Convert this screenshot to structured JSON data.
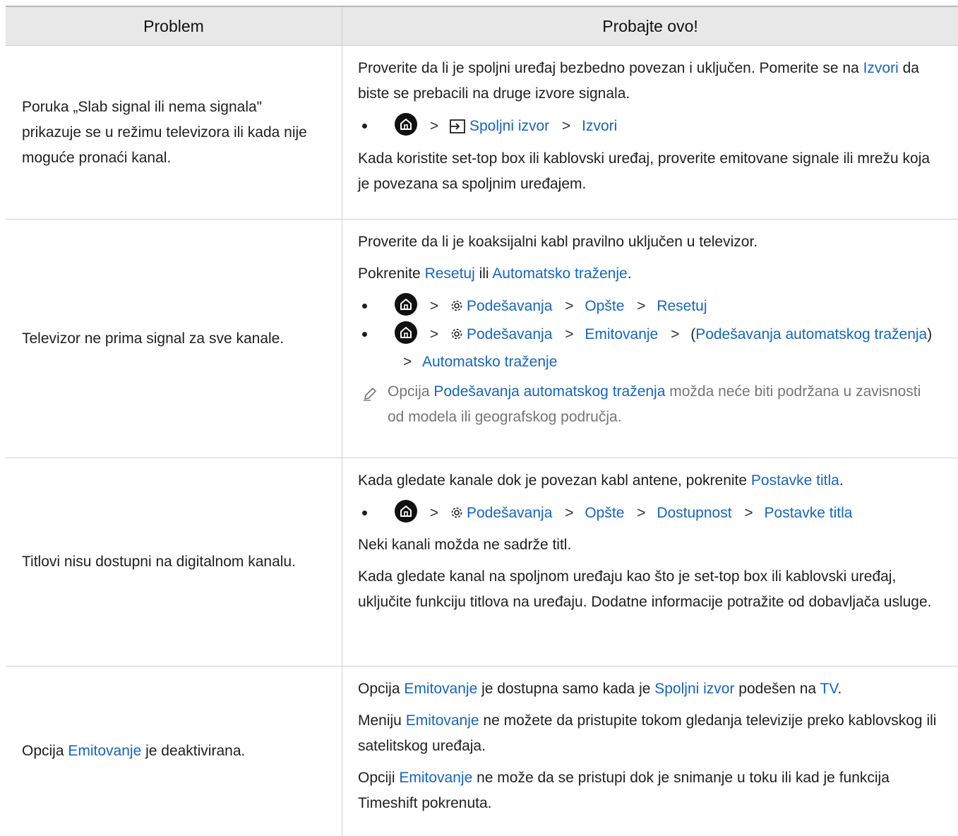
{
  "header": {
    "col_problem": "Problem",
    "col_try": "Probajte ovo!"
  },
  "rows": [
    {
      "problem": "Poruka „Slab signal ili nema signala\" prikazuje se u režimu televizora ili kada nije moguće pronaći kanal.",
      "p1_a": "Proverite da li je spoljni uređaj bezbedno povezan i uključen. Pomerite se na ",
      "p1_link": "Izvori",
      "p1_b": " da biste se prebacili na druge izvore signala.",
      "path_1": "Spoljni izvor",
      "path_2": "Izvori",
      "p2": "Kada koristite set-top box ili kablovski uređaj, proverite emitovane signale ili mrežu koja je povezana sa spoljnim uređajem."
    },
    {
      "problem": "Televizor ne prima signal za sve kanale.",
      "p1": "Proverite da li je koaksijalni kabl pravilno uključen u televizor.",
      "p2_a": "Pokrenite ",
      "p2_link1": "Resetuj",
      "p2_mid": " ili ",
      "p2_link2": "Automatsko traženje",
      "p2_end": ".",
      "pathA_1": "Podešavanja",
      "pathA_2": "Opšte",
      "pathA_3": "Resetuj",
      "pathB_1": "Podešavanja",
      "pathB_2": "Emitovanje",
      "pathB_paren_open": "(",
      "pathB_3": "Podešavanja automatskog traženja",
      "pathB_paren_close": ")",
      "pathB_4": "Automatsko traženje",
      "note_a": "Opcija ",
      "note_link": "Podešavanja automatskog traženja",
      "note_b": " možda neće biti podržana u zavisnosti od modela ili geografskog područja."
    },
    {
      "problem": "Titlovi nisu dostupni na digitalnom kanalu.",
      "p1_a": "Kada gledate kanale dok je povezan kabl antene, pokrenite ",
      "p1_link": "Postavke titla",
      "p1_end": ".",
      "path_1": "Podešavanja",
      "path_2": "Opšte",
      "path_3": "Dostupnost",
      "path_4": "Postavke titla",
      "p2": "Neki kanali možda ne sadrže titl.",
      "p3": "Kada gledate kanal na spoljnom uređaju kao što je set-top box ili kablovski uređaj, uključite funkciju titlova na uređaju. Dodatne informacije potražite od dobavljača usluge."
    },
    {
      "problem_a": "Opcija ",
      "problem_link": "Emitovanje",
      "problem_b": " je deaktivirana.",
      "p1_a": "Opcija ",
      "p1_link1": "Emitovanje",
      "p1_mid1": " je dostupna samo kada je ",
      "p1_link2": "Spoljni izvor",
      "p1_mid2": " podešen na ",
      "p1_link3": "TV",
      "p1_end": ".",
      "p2_a": "Meniju ",
      "p2_link": "Emitovanje",
      "p2_b": " ne možete da pristupite tokom gledanja televizije preko kablovskog ili satelitskog uređaja.",
      "p3_a": "Opciji ",
      "p3_link": "Emitovanje",
      "p3_b": " ne može da se pristupi dok je snimanje u toku ili kad je funkcija Timeshift pokrenuta."
    }
  ],
  "icons": {
    "home": "home-icon",
    "chevron": "chevron-right-icon",
    "gear": "gear-icon",
    "source": "source-input-icon",
    "note": "pencil-note-icon"
  },
  "colors": {
    "link": "#1565c0",
    "header_bg": "#e8e8e8",
    "note_text": "#757575"
  }
}
